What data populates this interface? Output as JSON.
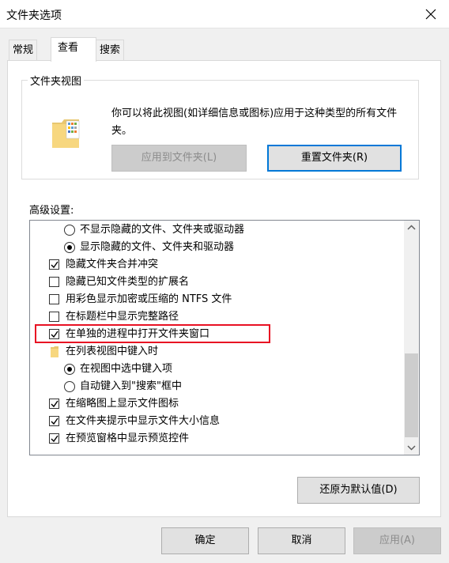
{
  "window": {
    "title": "文件夹选项"
  },
  "tabs": [
    {
      "label": "常规"
    },
    {
      "label": "查看"
    },
    {
      "label": "搜索"
    }
  ],
  "folder_views": {
    "legend": "文件夹视图",
    "description": "你可以将此视图(如详细信息或图标)应用于这种类型的所有文件夹。",
    "apply_button": "应用到文件夹(L)",
    "reset_button": "重置文件夹(R)"
  },
  "advanced": {
    "label": "高级设置:",
    "items": [
      {
        "type": "radio",
        "checked": false,
        "label": "不显示隐藏的文件、文件夹或驱动器"
      },
      {
        "type": "radio",
        "checked": true,
        "label": "显示隐藏的文件、文件夹和驱动器"
      },
      {
        "type": "checkbox",
        "checked": true,
        "label": "隐藏文件夹合并冲突"
      },
      {
        "type": "checkbox",
        "checked": false,
        "label": "隐藏已知文件类型的扩展名"
      },
      {
        "type": "checkbox",
        "checked": false,
        "label": "用彩色显示加密或压缩的 NTFS 文件"
      },
      {
        "type": "checkbox",
        "checked": false,
        "label": "在标题栏中显示完整路径"
      },
      {
        "type": "checkbox",
        "checked": true,
        "label": "在单独的进程中打开文件夹窗口"
      },
      {
        "type": "folder",
        "label": "在列表视图中键入时"
      },
      {
        "type": "radio",
        "checked": true,
        "label": "在视图中选中键入项"
      },
      {
        "type": "radio",
        "checked": false,
        "label": "自动键入到\"搜索\"框中"
      },
      {
        "type": "checkbox",
        "checked": true,
        "label": "在缩略图上显示文件图标"
      },
      {
        "type": "checkbox",
        "checked": true,
        "label": "在文件夹提示中显示文件大小信息"
      },
      {
        "type": "checkbox",
        "checked": true,
        "label": "在预览窗格中显示预览控件"
      }
    ]
  },
  "buttons": {
    "restore_defaults": "还原为默认值(D)",
    "ok": "确定",
    "cancel": "取消",
    "apply": "应用(A)"
  },
  "colors": {
    "highlight": "#e81123",
    "accent": "#0078d7"
  }
}
